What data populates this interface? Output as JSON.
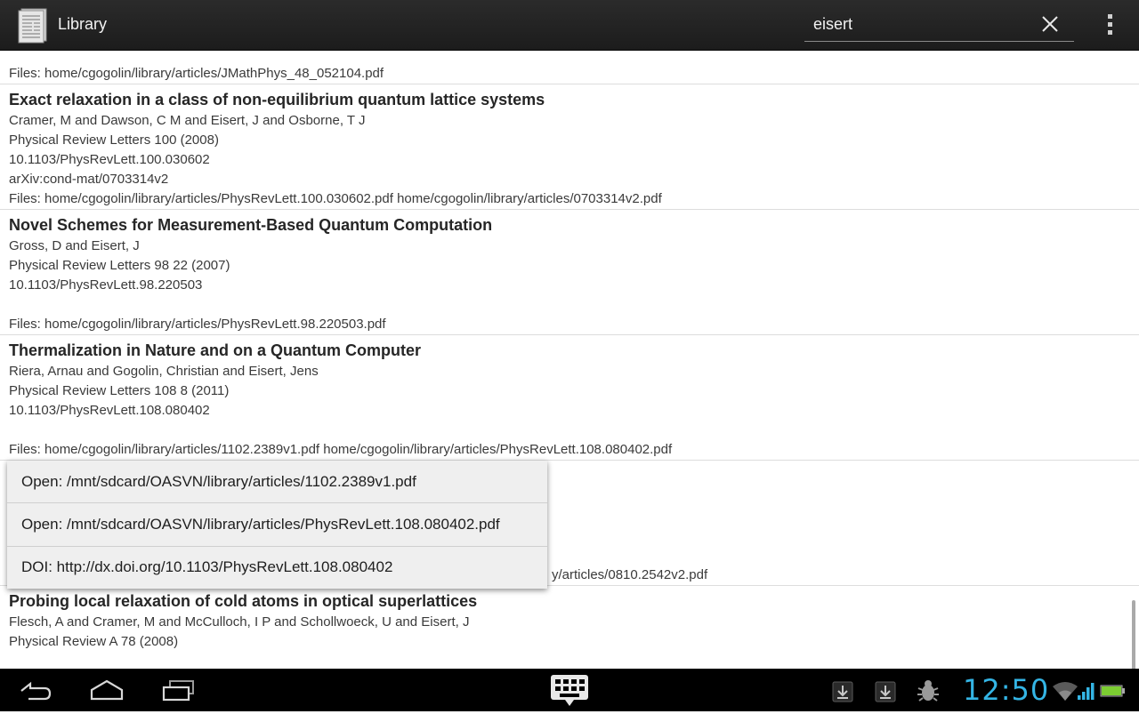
{
  "app": {
    "title": "Library"
  },
  "search": {
    "value": "eisert"
  },
  "entries": [
    {
      "lines": [
        "Files: home/cgogolin/library/articles/JMathPhys_48_052104.pdf"
      ]
    },
    {
      "title": "Exact relaxation in a class of non-equilibrium quantum lattice systems",
      "lines": [
        "Cramer, M and Dawson, C M and Eisert, J and Osborne, T J",
        "Physical Review Letters 100 (2008)",
        "10.1103/PhysRevLett.100.030602",
        "arXiv:cond-mat/0703314v2",
        "Files: home/cgogolin/library/articles/PhysRevLett.100.030602.pdf home/cgogolin/library/articles/0703314v2.pdf"
      ]
    },
    {
      "title": "Novel Schemes for Measurement-Based Quantum Computation",
      "lines": [
        "Gross, D and Eisert, J",
        "Physical Review Letters 98 22 (2007)",
        "10.1103/PhysRevLett.98.220503",
        "",
        "Files: home/cgogolin/library/articles/PhysRevLett.98.220503.pdf"
      ]
    },
    {
      "title": "Thermalization in Nature and on a Quantum Computer",
      "lines": [
        "Riera, Arnau and Gogolin, Christian and Eisert, Jens",
        "Physical Review Letters 108 8 (2011)",
        "10.1103/PhysRevLett.108.080402",
        "",
        "Files: home/cgogolin/library/articles/1102.2389v1.pdf home/cgogolin/library/articles/PhysRevLett.108.080402.pdf"
      ]
    },
    {
      "lines": [
        "y/articles/0810.2542v2.pdf"
      ]
    },
    {
      "title": "Probing local relaxation of cold atoms in optical superlattices",
      "lines": [
        "Flesch, A and Cramer, M and McCulloch, I P and Schollwoeck, U and Eisert, J",
        "Physical Review A 78 (2008)"
      ]
    }
  ],
  "popup": {
    "items": [
      "Open: /mnt/sdcard/OASVN/library/articles/1102.2389v1.pdf",
      "Open: /mnt/sdcard/OASVN/library/articles/PhysRevLett.108.080402.pdf",
      "DOI: http://dx.doi.org/10.1103/PhysRevLett.108.080402"
    ]
  },
  "system": {
    "clock": "12:50"
  },
  "icons": {
    "app": "library-document-icon",
    "clear": "close-icon",
    "overflow": "overflow-menu-icon",
    "back": "back-icon",
    "home": "home-icon",
    "recents": "recent-apps-icon",
    "keyboard": "keyboard-icon",
    "download": "download-icon",
    "debug": "bug-icon",
    "wifi": "wifi-icon",
    "signal": "cell-signal-icon",
    "battery": "battery-icon"
  },
  "colors": {
    "accent": "#34b5e5",
    "actionbar": "#222222",
    "battery": "#7ccd32"
  }
}
